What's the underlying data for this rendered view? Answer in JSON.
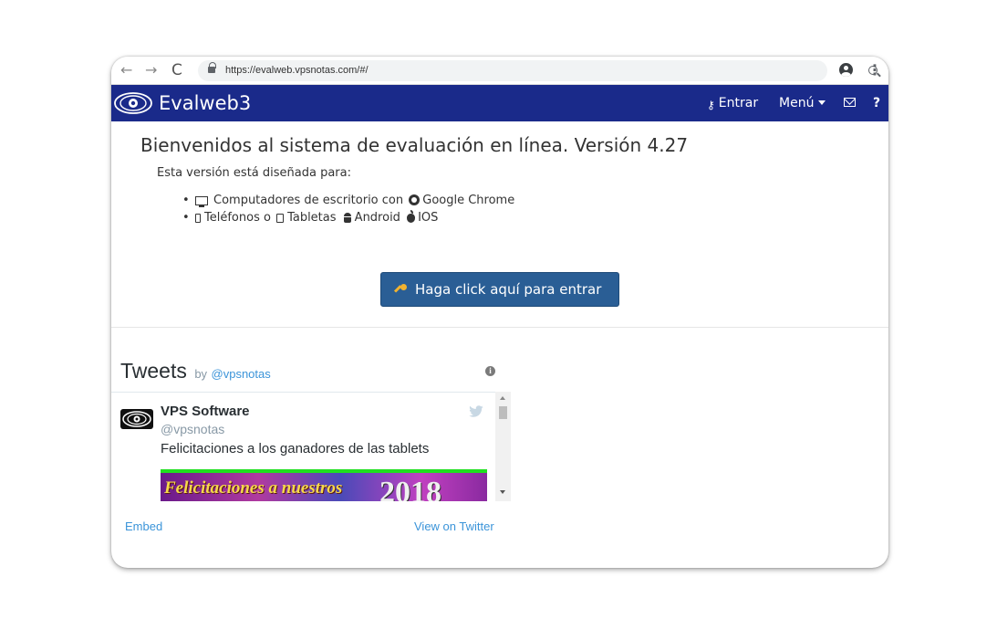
{
  "browser": {
    "url": "https://evalweb.vpsnotas.com/#/"
  },
  "navbar": {
    "brand": "Evalweb3",
    "entrar": "Entrar",
    "menu": "Menú",
    "help": "?",
    "bg_color": "#1a2a8a"
  },
  "main": {
    "welcome": "Bienvenidos al sistema de evaluación en línea. Versión 4.27",
    "designed_for": "Esta versión está diseñada para:",
    "item1": {
      "text1": "Computadores de escritorio con",
      "text2": "Google Chrome"
    },
    "item2": {
      "text1": "Teléfonos o",
      "text2": "Tabletas",
      "text3": "Android",
      "text4": "IOS"
    },
    "enter_button": "Haga click aquí para entrar"
  },
  "tweets": {
    "title": "Tweets",
    "by": "by",
    "handle": "@vpsnotas",
    "tweet": {
      "name": "VPS Software",
      "user": "@vpsnotas",
      "text": "Felicitaciones a los ganadores de las tablets",
      "image_text": "Felicitaciones a nuestros",
      "image_year": "2018"
    },
    "embed": "Embed",
    "view_on_twitter": "View on Twitter"
  }
}
